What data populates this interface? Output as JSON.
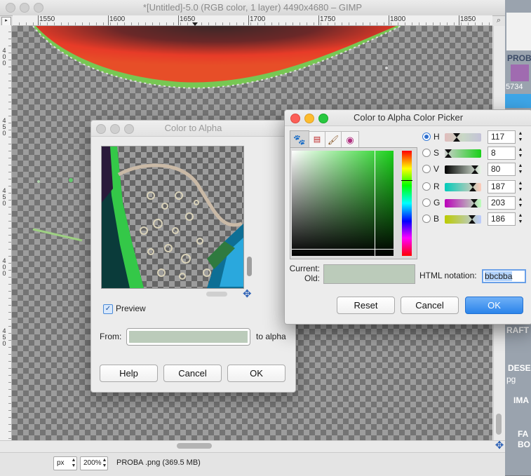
{
  "window": {
    "title": "*[Untitled]-5.0 (RGB color, 1 layer) 4490x4680 – GIMP"
  },
  "ruler": {
    "ticks": [
      "1550",
      "1600",
      "1650",
      "1700",
      "1750",
      "1800",
      "1850"
    ],
    "left_groups": [
      "400",
      "450",
      "450",
      "400",
      "450"
    ]
  },
  "status": {
    "unit": "px",
    "zoom": "200%",
    "file_info": "PROBA .png (369.5 MB)"
  },
  "background_app": {
    "texts": [
      "PROB",
      "5734",
      "RAFT",
      "DESE",
      "pg",
      "IMA",
      "FA",
      "BO"
    ]
  },
  "color_to_alpha": {
    "title": "Color to Alpha",
    "preview_label": "Preview",
    "preview_checked": true,
    "from_label": "From:",
    "to_label": "to alpha",
    "from_color": "#bbcbba",
    "buttons": {
      "help": "Help",
      "cancel": "Cancel",
      "ok": "OK"
    }
  },
  "color_picker": {
    "title": "Color to Alpha Color Picker",
    "current_label": "Current:",
    "old_label": "Old:",
    "current_color": "#bbcbba",
    "html_label": "HTML notation:",
    "html_value": "bbcbba",
    "channels": [
      {
        "key": "H",
        "value": "117",
        "selected": true
      },
      {
        "key": "S",
        "value": "8",
        "selected": false
      },
      {
        "key": "V",
        "value": "80",
        "selected": false
      },
      {
        "key": "R",
        "value": "187",
        "selected": false
      },
      {
        "key": "G",
        "value": "203",
        "selected": false
      },
      {
        "key": "B",
        "value": "186",
        "selected": false
      }
    ],
    "buttons": {
      "reset": "Reset",
      "cancel": "Cancel",
      "ok": "OK"
    },
    "accent": "#2a84ea"
  }
}
